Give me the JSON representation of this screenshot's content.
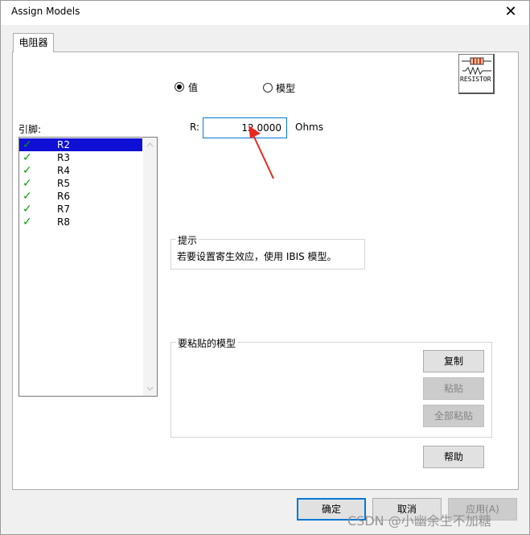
{
  "window": {
    "title": "Assign Models",
    "close_glyph": "✕"
  },
  "tab": {
    "label": "电阻器"
  },
  "model_icon": {
    "text": "RESISTOR"
  },
  "mode": {
    "value_label": "值",
    "model_label": "模型",
    "selected": "value"
  },
  "pins": {
    "label": "引脚:",
    "items": [
      {
        "name": "R2",
        "checked": true,
        "selected": true
      },
      {
        "name": "R3",
        "checked": true
      },
      {
        "name": "R4",
        "checked": true
      },
      {
        "name": "R5",
        "checked": true
      },
      {
        "name": "R6",
        "checked": true
      },
      {
        "name": "R7",
        "checked": true
      },
      {
        "name": "R8",
        "checked": true
      }
    ]
  },
  "resistance": {
    "label": "R:",
    "value": "12.0000",
    "unit": "Ohms"
  },
  "hint": {
    "title": "提示",
    "text": "若要设置寄生效应，使用 IBIS 模型。"
  },
  "paste_group": {
    "title": "要粘贴的模型",
    "copy_label": "复制",
    "paste_label": "粘贴",
    "paste_all_label": "全部粘贴"
  },
  "help_label": "帮助",
  "footer": {
    "ok_label": "确定",
    "cancel_label": "取消",
    "apply_label": "应用(A)"
  },
  "watermark": "CSDN @小幽余生不加糖",
  "colors": {
    "selection": "#0f0fd6",
    "check": "#0a9b0a",
    "focus_border": "#0078d7",
    "arrow": "#e8281e"
  }
}
